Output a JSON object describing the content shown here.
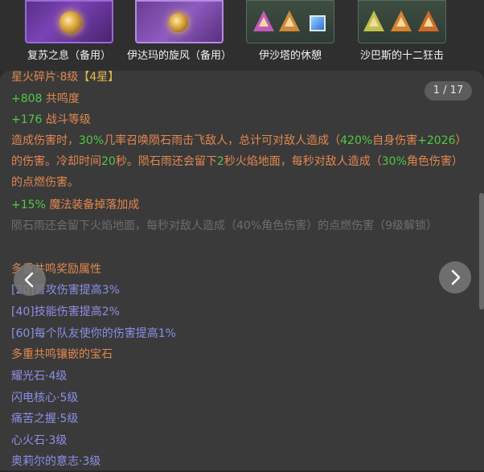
{
  "items": [
    {
      "label": "复苏之息（备用）"
    },
    {
      "label": "伊达玛的旋风（备用）"
    },
    {
      "label": "伊沙塔的休憩"
    },
    {
      "label": "沙巴斯的十二狂击"
    }
  ],
  "pager": {
    "text": "1 / 17"
  },
  "header": {
    "name": "星火碎片·8级",
    "stars": "【4星】"
  },
  "stats": [
    {
      "value": "+808",
      "name": "共鸣度"
    },
    {
      "value": "+176",
      "name": "战斗等级"
    }
  ],
  "effect": {
    "p1": "造成伤害时，",
    "p2": "30%",
    "p3": "几率召唤陨石雨击飞敌人，总计可对敌人造成（",
    "p4": "420%",
    "p5": "自身伤害",
    "p6": "+2026",
    "p7": "）的伤害。冷却时间",
    "p8": "20",
    "p9": "秒。陨石雨还会留下",
    "p10": "2",
    "p11": "秒火焰地面，每秒对敌人造成（",
    "p12": "30%",
    "p13": "角色伤害）的点燃伤害。"
  },
  "drop": {
    "value": "+15%",
    "name": "魔法装备掉落加成"
  },
  "locked": "陨石雨还会留下火焰地面，每秒对敌人造成（40%角色伤害）的点燃伤害（9级解锁）",
  "bonus_title": "多重共鸣奖励属性",
  "bonuses": [
    "[20]普攻伤害提高3%",
    "[40]技能伤害提高2%",
    "[60]每个队友使你的伤害提高1%"
  ],
  "gems_title": "多重共鸣镶嵌的宝石",
  "gems": [
    "耀光石·4级",
    "闪电核心·5级",
    "痛苦之握·5级",
    "心火石·3级",
    "奥莉尔的意志·3级"
  ],
  "nav": {
    "prev_icon": "chevron-left-icon",
    "next_icon": "chevron-right-icon"
  }
}
